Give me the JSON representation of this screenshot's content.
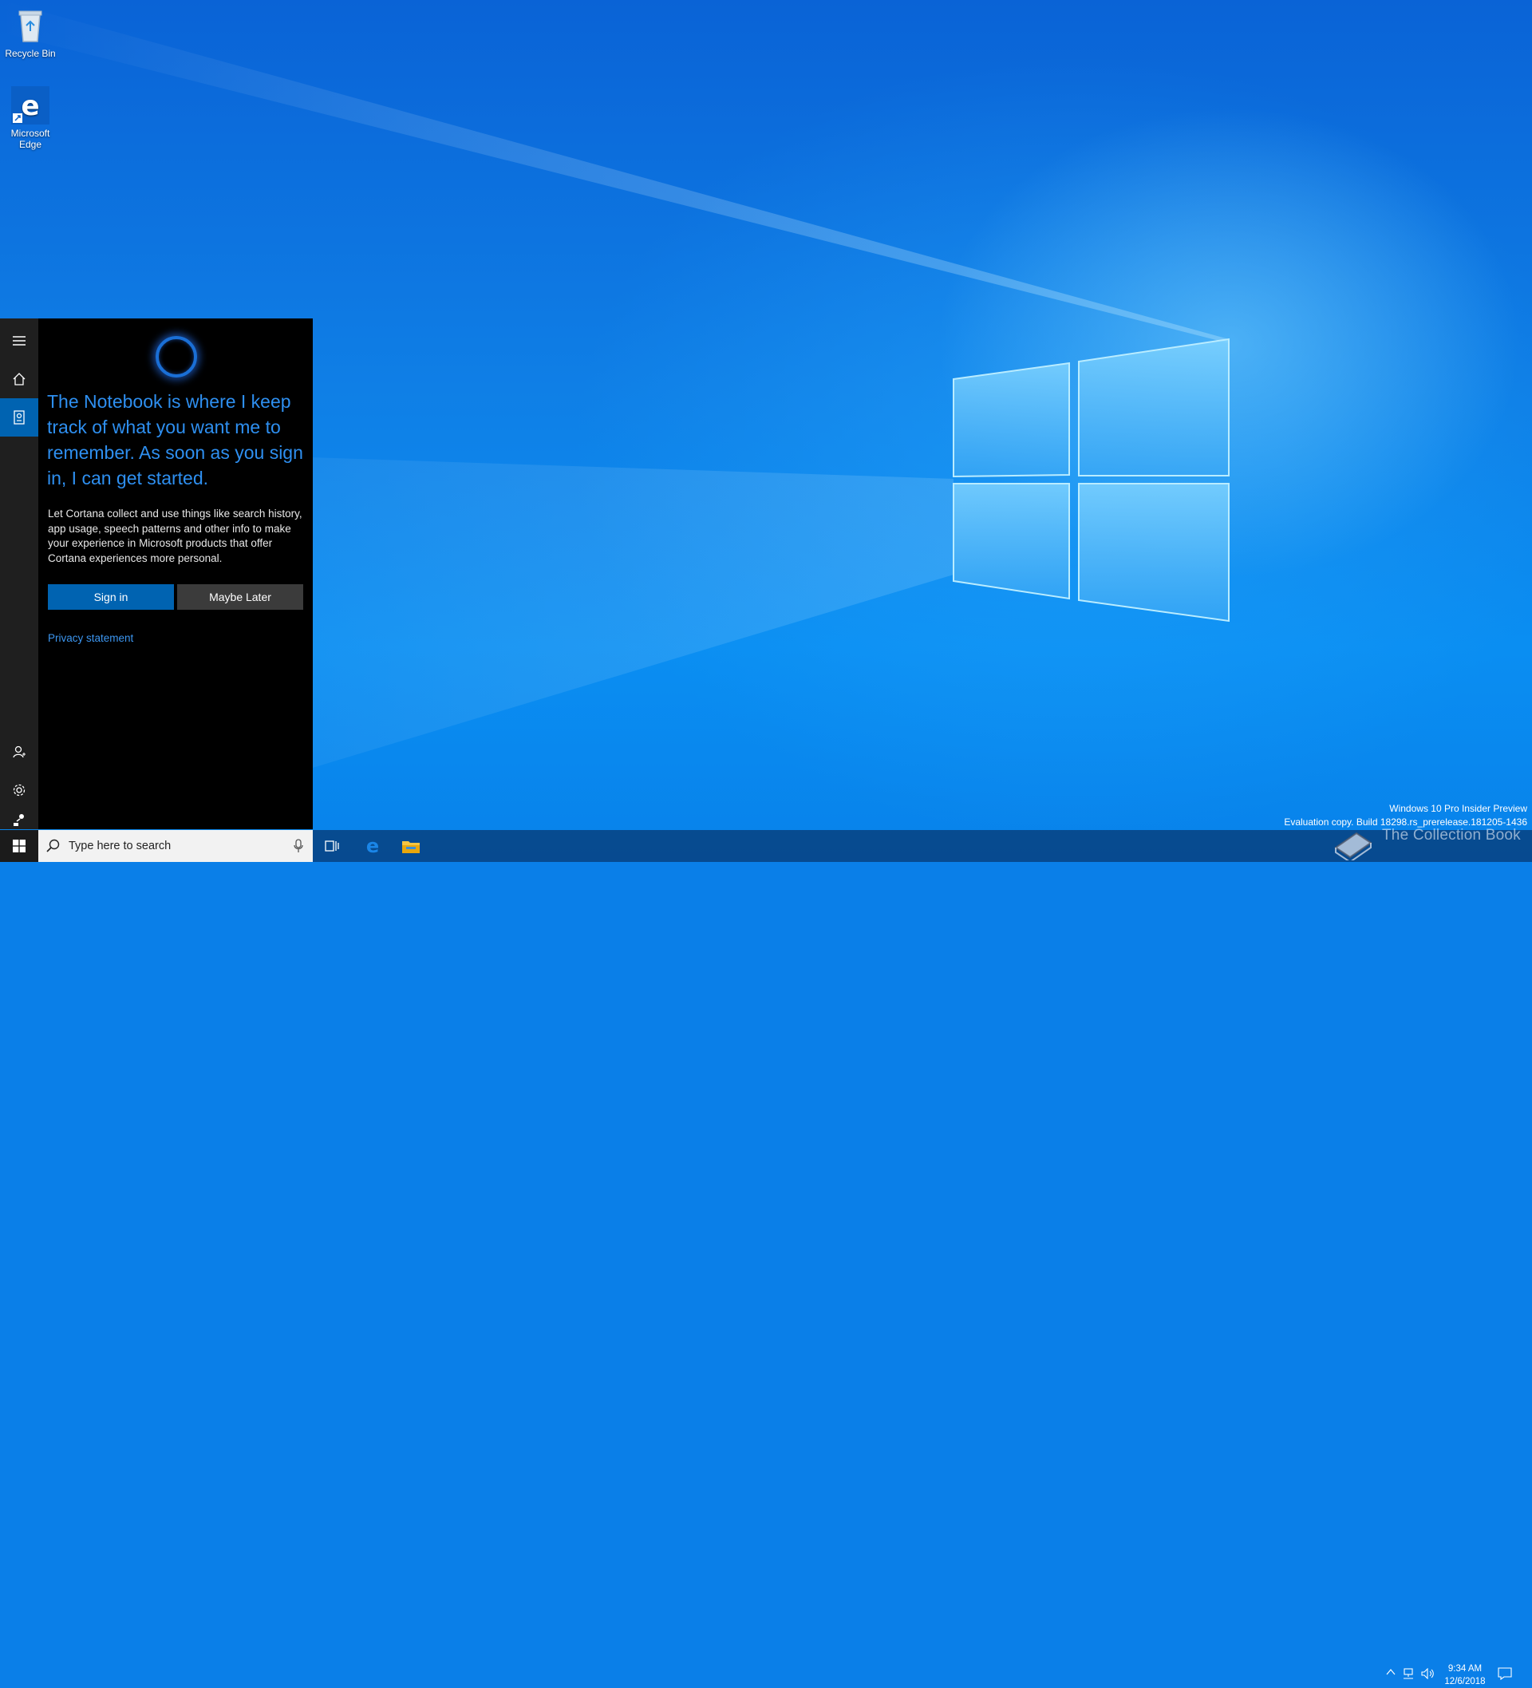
{
  "desktop": {
    "icons": [
      {
        "label": "Recycle Bin",
        "icon": "recycle-bin-icon"
      },
      {
        "label": "Microsoft Edge",
        "icon": "edge-icon"
      }
    ]
  },
  "cortana": {
    "rail": [
      "hamburger-menu-icon",
      "home-icon",
      "notebook-icon",
      "person-icon",
      "gear-icon",
      "feedback-icon"
    ],
    "headline": "The Notebook is where I keep track of what you want me to remember. As soon as you sign in, I can get started.",
    "body": "Let Cortana collect and use things like search history, app usage, speech patterns and other info to make your experience in Microsoft products that offer Cortana experiences more personal.",
    "sign_in_label": "Sign in",
    "maybe_later_label": "Maybe Later",
    "privacy_label": "Privacy statement",
    "colors": {
      "accent": "#0063b1",
      "headline": "#2e8ff0",
      "link": "#3c96f0"
    }
  },
  "taskbar": {
    "search_placeholder": "Type here to search",
    "apps": [
      "task-view-icon",
      "edge-icon",
      "file-explorer-icon"
    ],
    "clock_time": "9:34 AM",
    "clock_date": "12/6/2018"
  },
  "watermark": {
    "line1": "Windows 10 Pro Insider Preview",
    "line2": "Evaluation copy. Build 18298.rs_prerelease.181205-1436",
    "overlay": "The Collection Book"
  }
}
